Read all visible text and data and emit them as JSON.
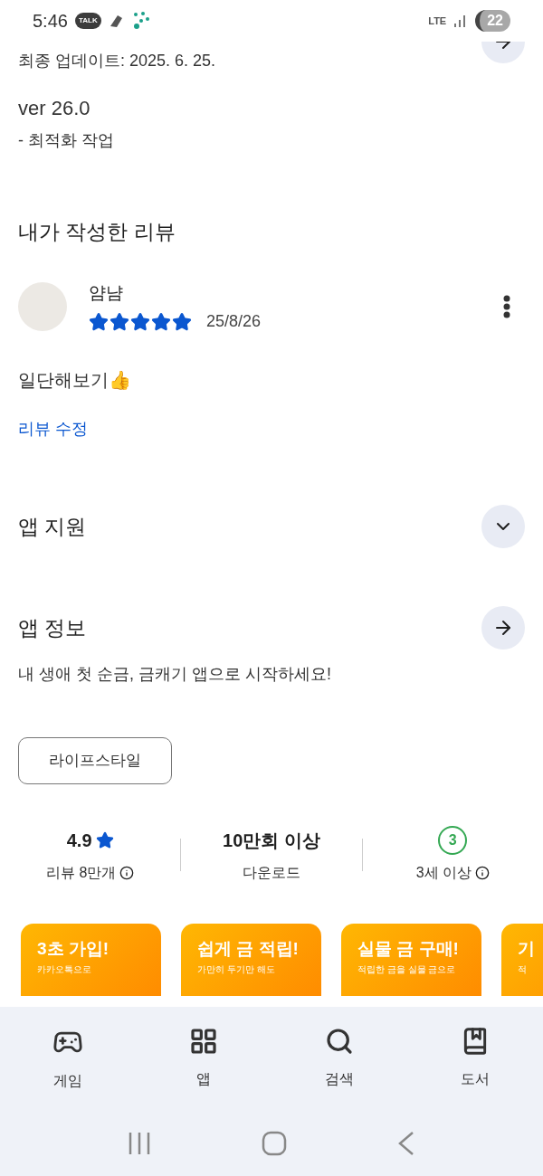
{
  "status_bar": {
    "time": "5:46",
    "chat_badge": "TALK",
    "network": "LTE",
    "battery": "22"
  },
  "update": {
    "label": "최종 업데이트: 2025. 6. 25.",
    "version": "ver 26.0",
    "notes": "- 최적화 작업"
  },
  "my_review": {
    "title": "내가 작성한 리뷰",
    "author": "얌냠",
    "stars": 5,
    "date": "25/8/26",
    "text": "일단해보기👍",
    "edit_link": "리뷰 수정"
  },
  "app_support": {
    "title": "앱 지원"
  },
  "app_info": {
    "title": "앱 정보",
    "description": "내 생애 첫 순금, 금캐기 앱으로 시작하세요!",
    "tag": "라이프스타일"
  },
  "stats": [
    {
      "kind": "rating",
      "value": "4.9",
      "label": "리뷰 8만개",
      "info": true
    },
    {
      "kind": "text",
      "value": "10만회 이상",
      "label": "다운로드",
      "info": false
    },
    {
      "kind": "age",
      "value": "3",
      "label": "3세 이상",
      "info": true
    }
  ],
  "screenshots": [
    {
      "title": "3초 가입!",
      "subtitle": "카카오톡으로"
    },
    {
      "title": "쉽게 금 적립!",
      "subtitle": "가만히 두기만 해도"
    },
    {
      "title": "실물 금 구매!",
      "subtitle": "적립한 금을 실물 금으로"
    },
    {
      "title": "기",
      "subtitle": "적"
    }
  ],
  "bottom_nav": [
    {
      "kind": "games",
      "label": "게임"
    },
    {
      "kind": "apps",
      "label": "앱"
    },
    {
      "kind": "search",
      "label": "검색"
    },
    {
      "kind": "books",
      "label": "도서"
    }
  ]
}
